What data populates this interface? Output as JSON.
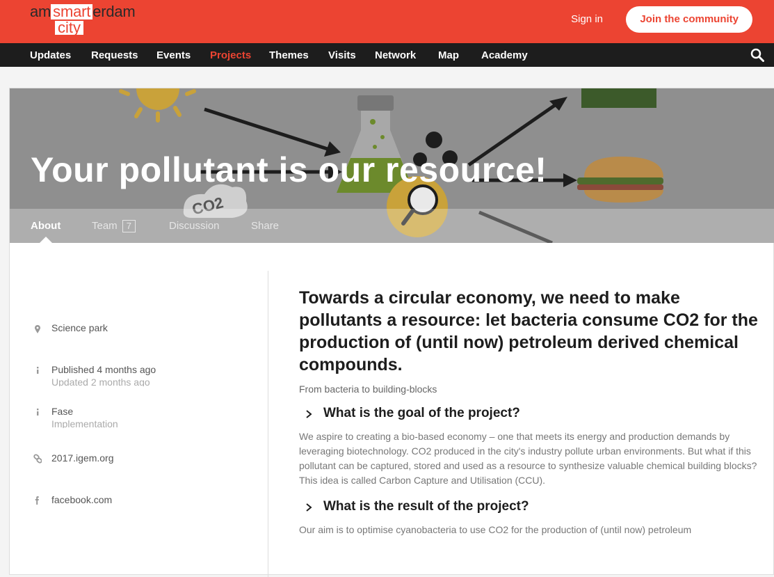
{
  "header": {
    "logo": {
      "line1_prefix": "am",
      "line1_box": "smart",
      "line1_suffix": "erdam",
      "line2": "city"
    },
    "sign_in": "Sign in",
    "join": "Join the community"
  },
  "nav": {
    "items": [
      "Updates",
      "Requests",
      "Events",
      "Projects",
      "Themes",
      "Visits",
      "Network",
      "Map",
      "Academy"
    ],
    "active": "Projects"
  },
  "hero": {
    "title": "Your pollutant is our resource!",
    "co2_label": "CO2"
  },
  "tabs": {
    "about": "About",
    "team": "Team",
    "team_count": "7",
    "discussion": "Discussion",
    "share": "Share"
  },
  "sidebar": {
    "location": "Science park",
    "published": "Published 4 months ago",
    "updated": "Updated 2 months ago",
    "phase_label": "Fase",
    "phase_value": "Implementation",
    "website": "2017.igem.org",
    "social": "facebook.com"
  },
  "content": {
    "headline": "Towards a circular economy, we need to make pollutants a resource: let bacteria consume CO2 for the production of (until now) petroleum derived chemical compounds.",
    "subheading": "From bacteria to building-blocks",
    "q1": "What is the goal of the project?",
    "p1": "We aspire to creating a bio-based economy – one that meets its energy and production demands by leveraging biotechnology. CO2 produced in the city's industry pollute urban environments. But what if this pollutant can be captured, stored and used as a resource to synthesize valuable chemical building blocks? This idea is called Carbon Capture and Utilisation (CCU).",
    "q2": "What is the result of the project?",
    "p2": "Our aim is to optimise cyanobacteria to use CO2 for the production of (until now) petroleum"
  },
  "colors": {
    "brand": "#ec4432",
    "nav_bg": "#1d1d1d"
  }
}
